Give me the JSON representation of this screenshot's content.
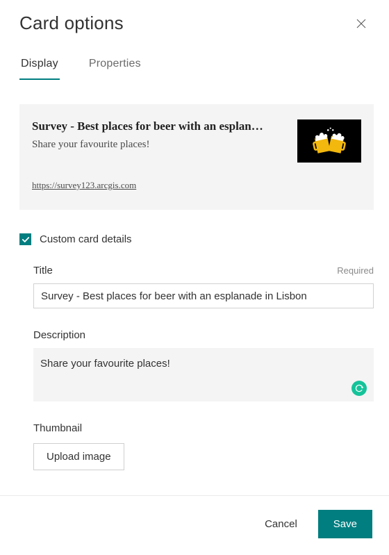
{
  "dialog": {
    "title": "Card options"
  },
  "tabs": {
    "display": "Display",
    "properties": "Properties"
  },
  "preview": {
    "title": "Survey - Best places for beer with an esplan…",
    "description": "Share your favourite places!",
    "link": "https://survey123.arcgis.com"
  },
  "checkbox": {
    "label": "Custom card details",
    "checked": true
  },
  "form": {
    "title_label": "Title",
    "required_label": "Required",
    "title_value": "Survey - Best places for beer with an esplanade in Lisbon",
    "description_label": "Description",
    "description_value": "Share your favourite places!",
    "thumbnail_label": "Thumbnail",
    "upload_label": "Upload image"
  },
  "footer": {
    "cancel": "Cancel",
    "save": "Save"
  },
  "colors": {
    "accent": "#007e80",
    "grammarly": "#15c39a"
  }
}
